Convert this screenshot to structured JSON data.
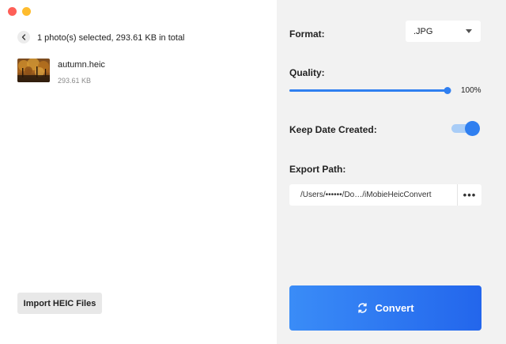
{
  "window": {
    "controls": [
      "close",
      "minimize"
    ]
  },
  "selection": {
    "summary": "1 photo(s) selected, 293.61 KB in total"
  },
  "files": [
    {
      "name": "autumn.heic",
      "size": "293.61 KB",
      "thumbnail": "autumn-forest-image"
    }
  ],
  "import_button": {
    "label": "Import HEIC Files"
  },
  "settings": {
    "format": {
      "label": "Format:",
      "value": ".JPG"
    },
    "quality": {
      "label": "Quality:",
      "value": "100%",
      "level_percent": 100
    },
    "keep_date": {
      "label": "Keep Date Created:",
      "enabled": true
    },
    "export_path": {
      "label": "Export Path:",
      "value": "/Users/••••••/Do…/iMobieHeicConvert",
      "more_label": "•••"
    }
  },
  "convert_button": {
    "label": "Convert",
    "icon": "refresh-icon"
  },
  "colors": {
    "accent": "#2f7ff0",
    "panel_bg": "#f2f2f2",
    "close": "#fe5f57",
    "minimize": "#febc2e"
  }
}
